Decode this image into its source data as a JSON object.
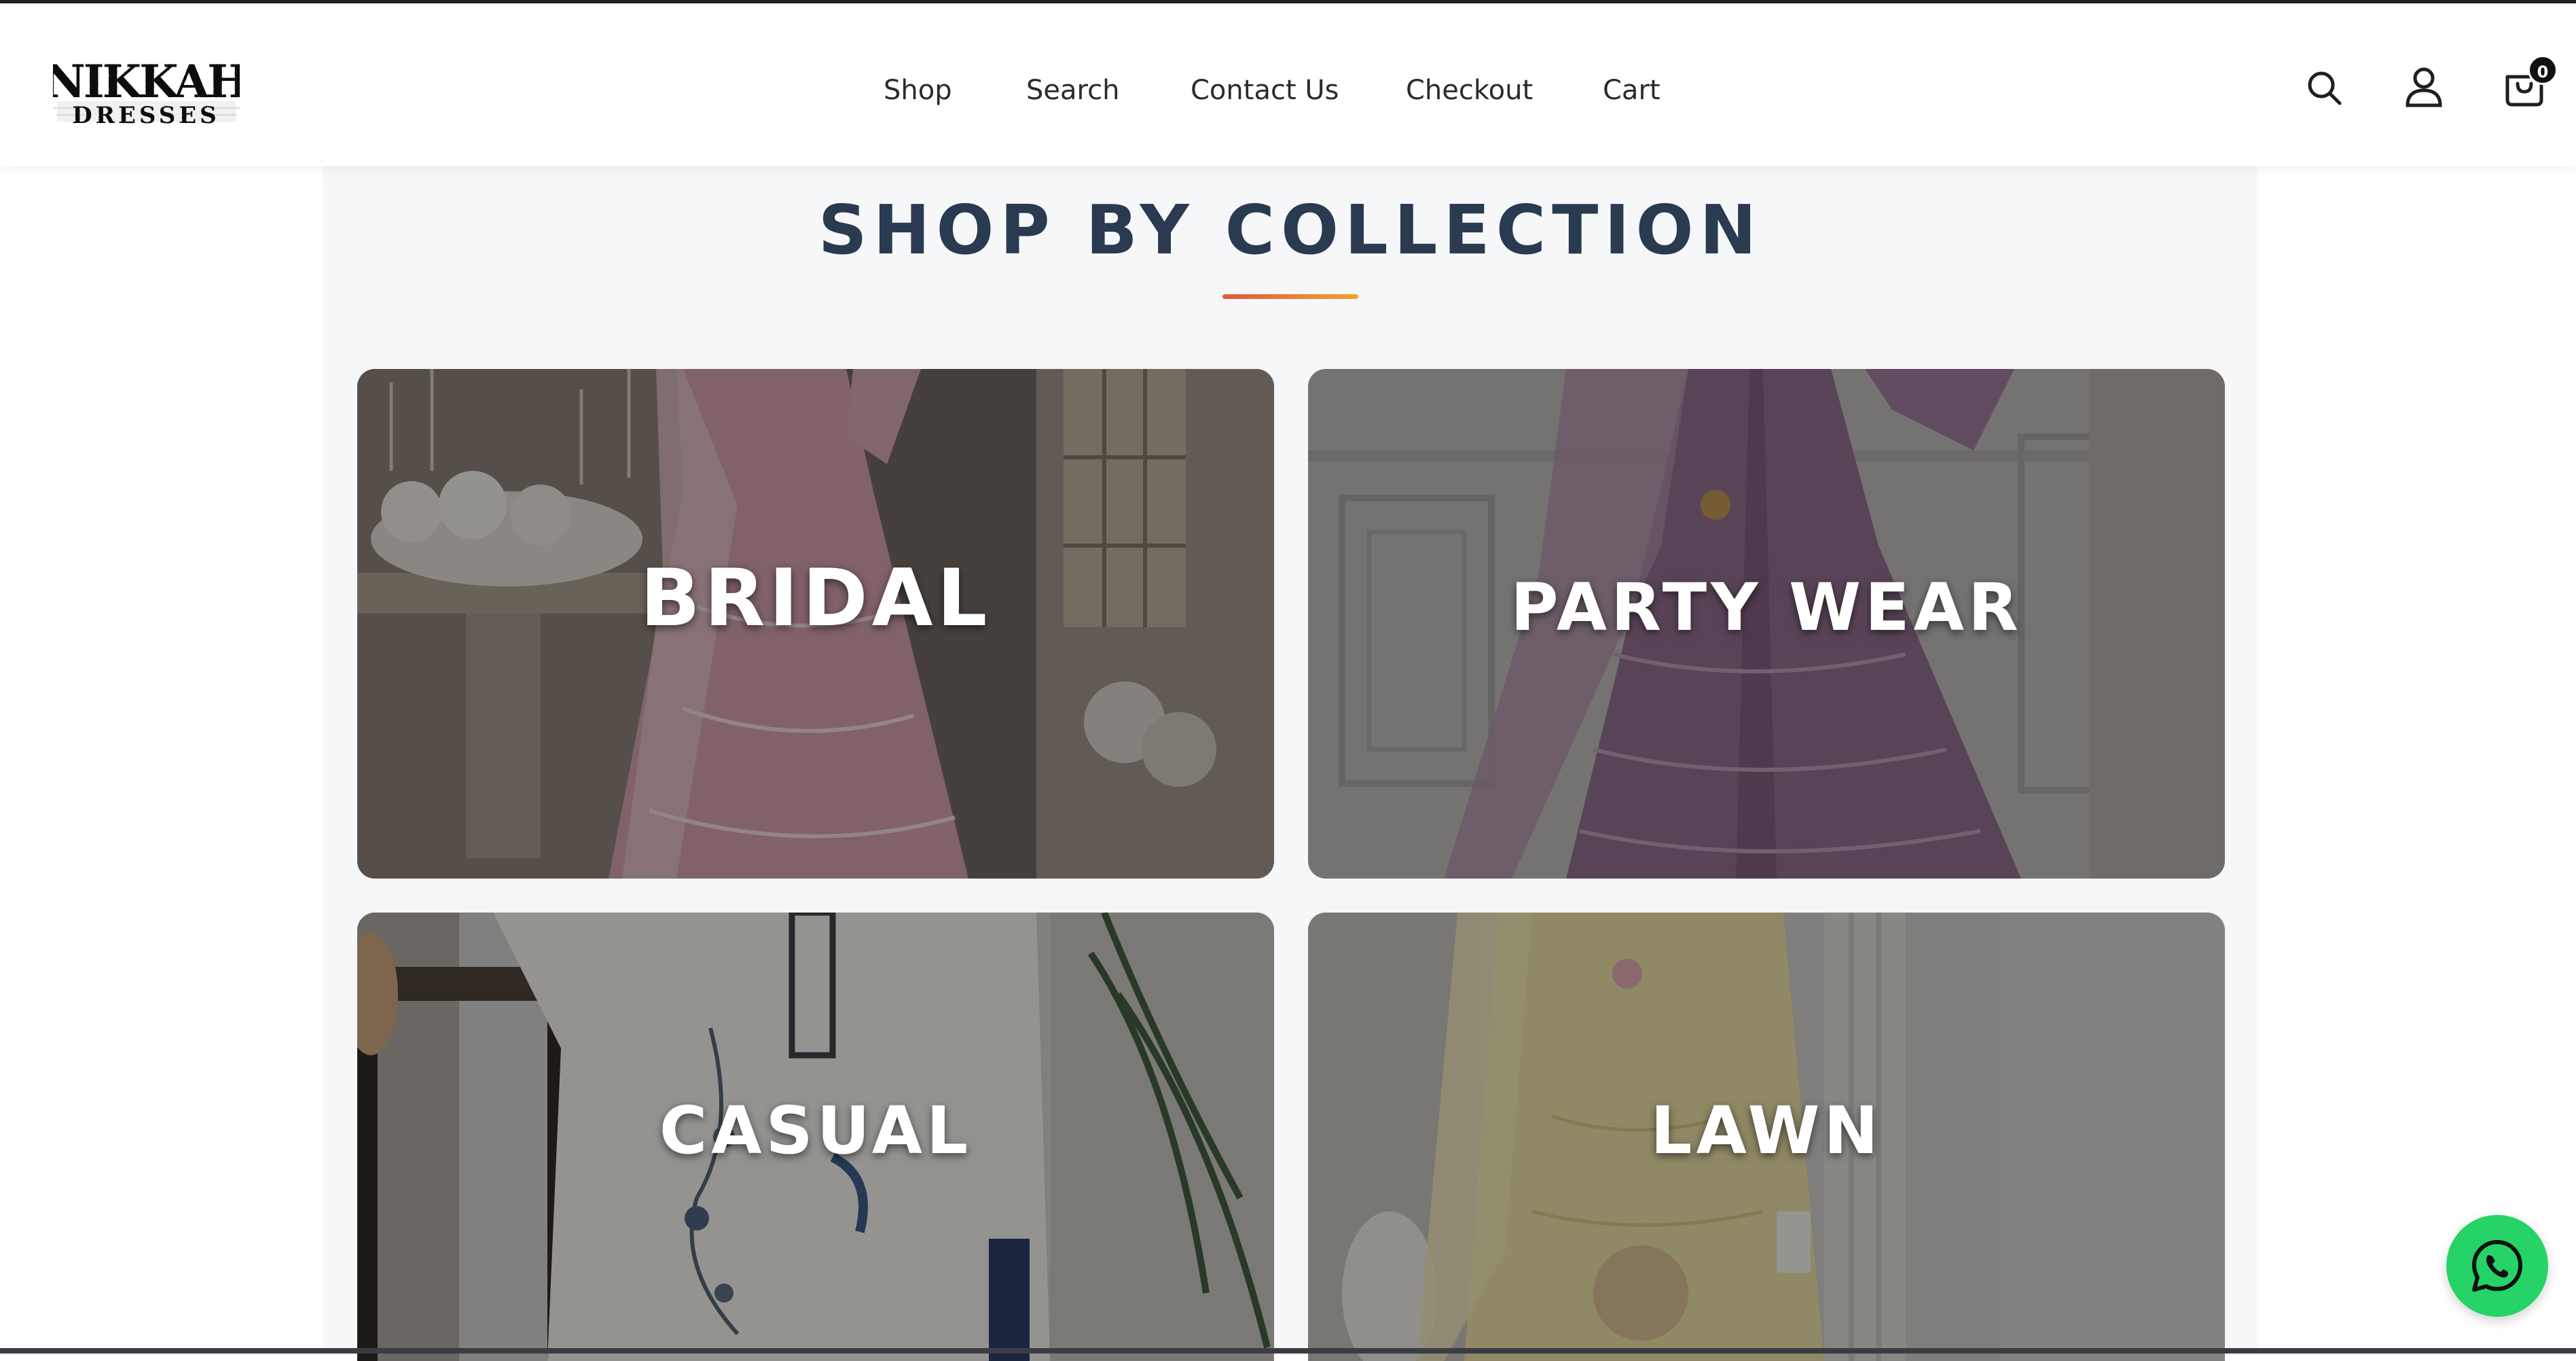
{
  "brand": {
    "logo_line1": "NIKKAH",
    "logo_line2": "DRESSES",
    "logo_icon": "nikkah-dresses-logo"
  },
  "nav": {
    "items": [
      {
        "label": "Shop"
      },
      {
        "label": "Search"
      },
      {
        "label": "Contact Us"
      },
      {
        "label": "Checkout"
      },
      {
        "label": "Cart"
      }
    ]
  },
  "header_icons": {
    "search": "search-icon",
    "account": "user-icon",
    "cart": "shopping-bag-icon",
    "cart_count": "0"
  },
  "section": {
    "title": "SHOP BY COLLECTION",
    "accent_gradient": [
      "#e05a3a",
      "#f2a22e"
    ],
    "title_color": "#2a3a50"
  },
  "collections": [
    {
      "label": "BRIDAL"
    },
    {
      "label": "PARTY WEAR"
    },
    {
      "label": "CASUAL"
    },
    {
      "label": "LAWN"
    }
  ],
  "whatsapp": {
    "icon": "whatsapp-icon",
    "color": "#25d366"
  }
}
